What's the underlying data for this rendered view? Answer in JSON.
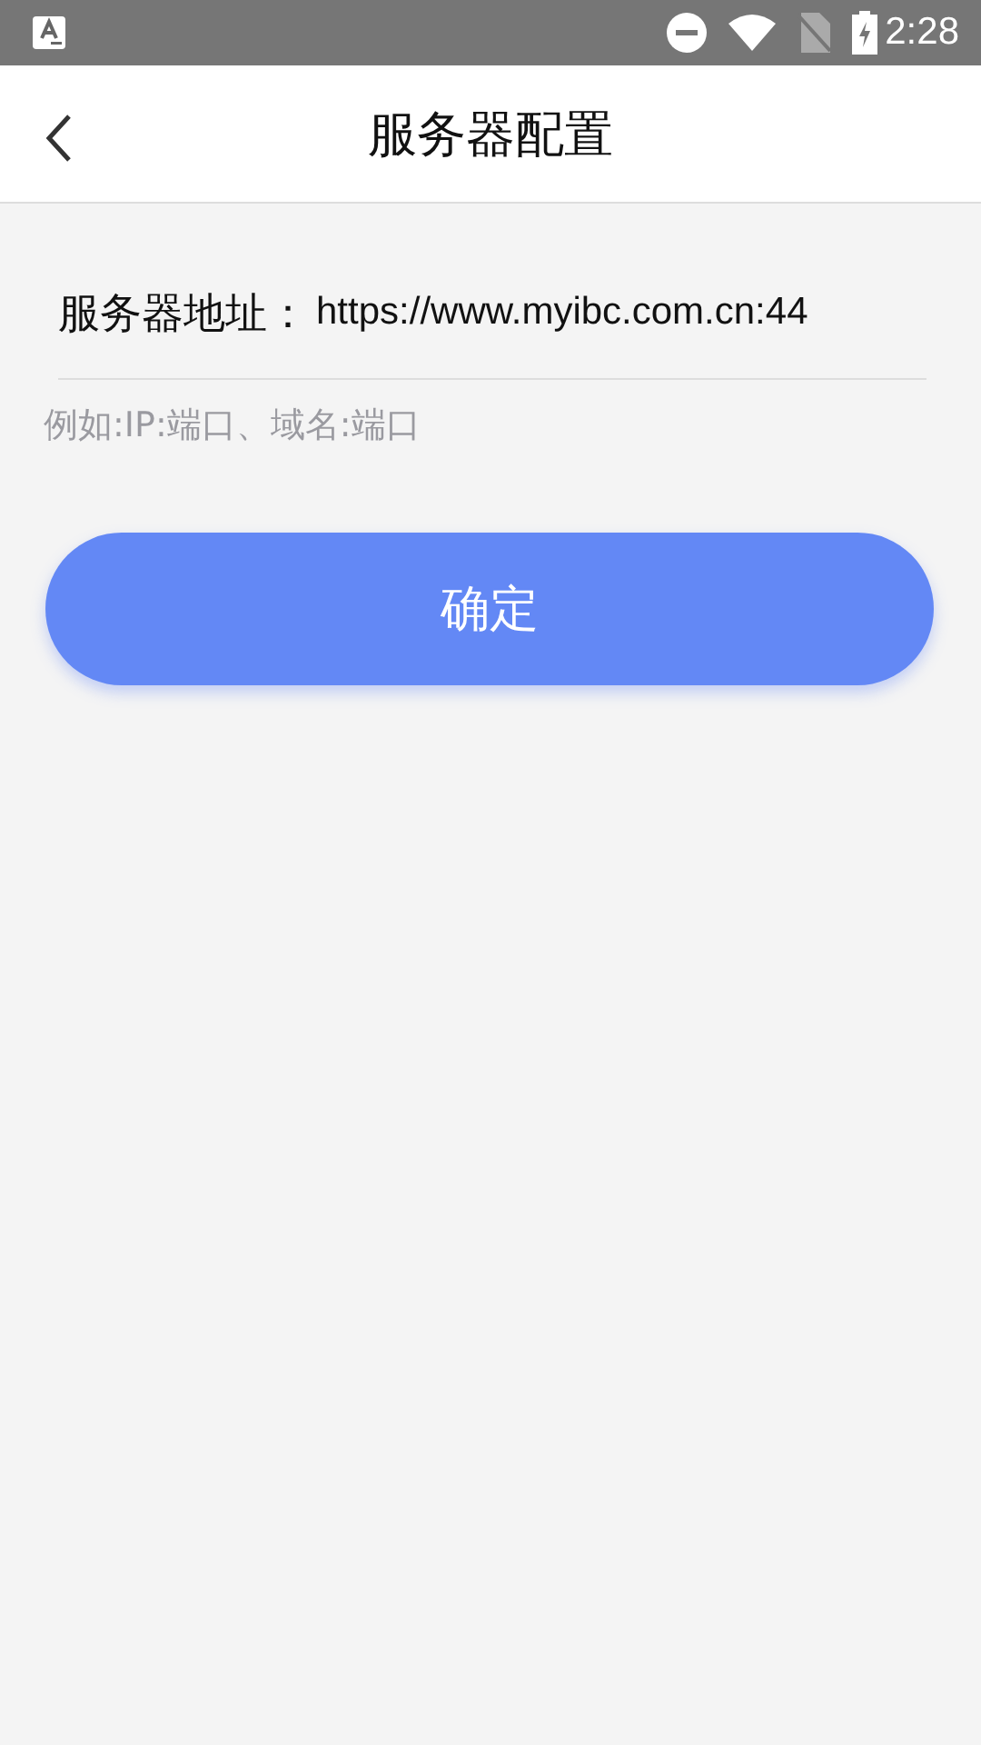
{
  "status_bar": {
    "time": "2:28"
  },
  "header": {
    "title": "服务器配置"
  },
  "server_field": {
    "label": "服务器地址：",
    "value": "https://www.myibc.com.cn:44"
  },
  "hint": "例如:IP:端口、域名:端口",
  "confirm_button": {
    "label": "确定"
  }
}
